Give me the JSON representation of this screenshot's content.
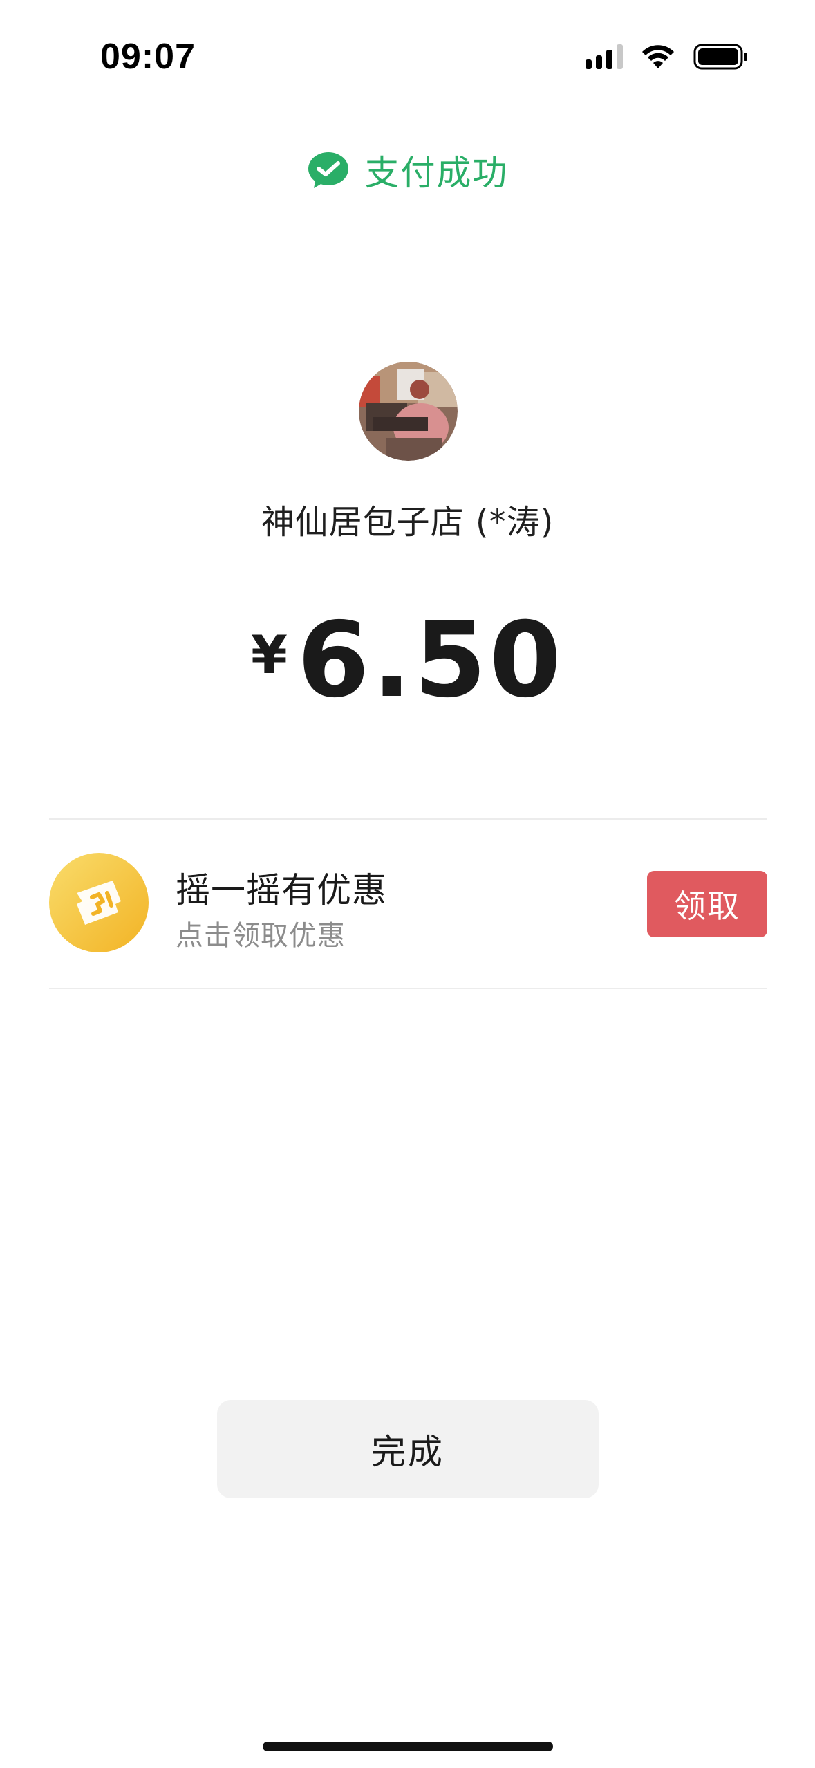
{
  "status_bar": {
    "time": "09:07",
    "signal_icon": "cellular-signal-icon",
    "wifi_icon": "wifi-icon",
    "battery_icon": "battery-icon"
  },
  "header": {
    "icon": "wechat-check-icon",
    "title": "支付成功",
    "accent_color": "#2aae67"
  },
  "merchant": {
    "avatar": "merchant-avatar-photo",
    "name": "神仙居包子店 (*涛)"
  },
  "payment": {
    "currency_symbol": "¥",
    "amount": "6.50"
  },
  "promo": {
    "icon": "coupon-badge-icon",
    "title": "摇一摇有优惠",
    "subtitle": "点击领取优惠",
    "button_label": "领取",
    "button_color": "#e05a5f"
  },
  "footer": {
    "done_label": "完成"
  }
}
